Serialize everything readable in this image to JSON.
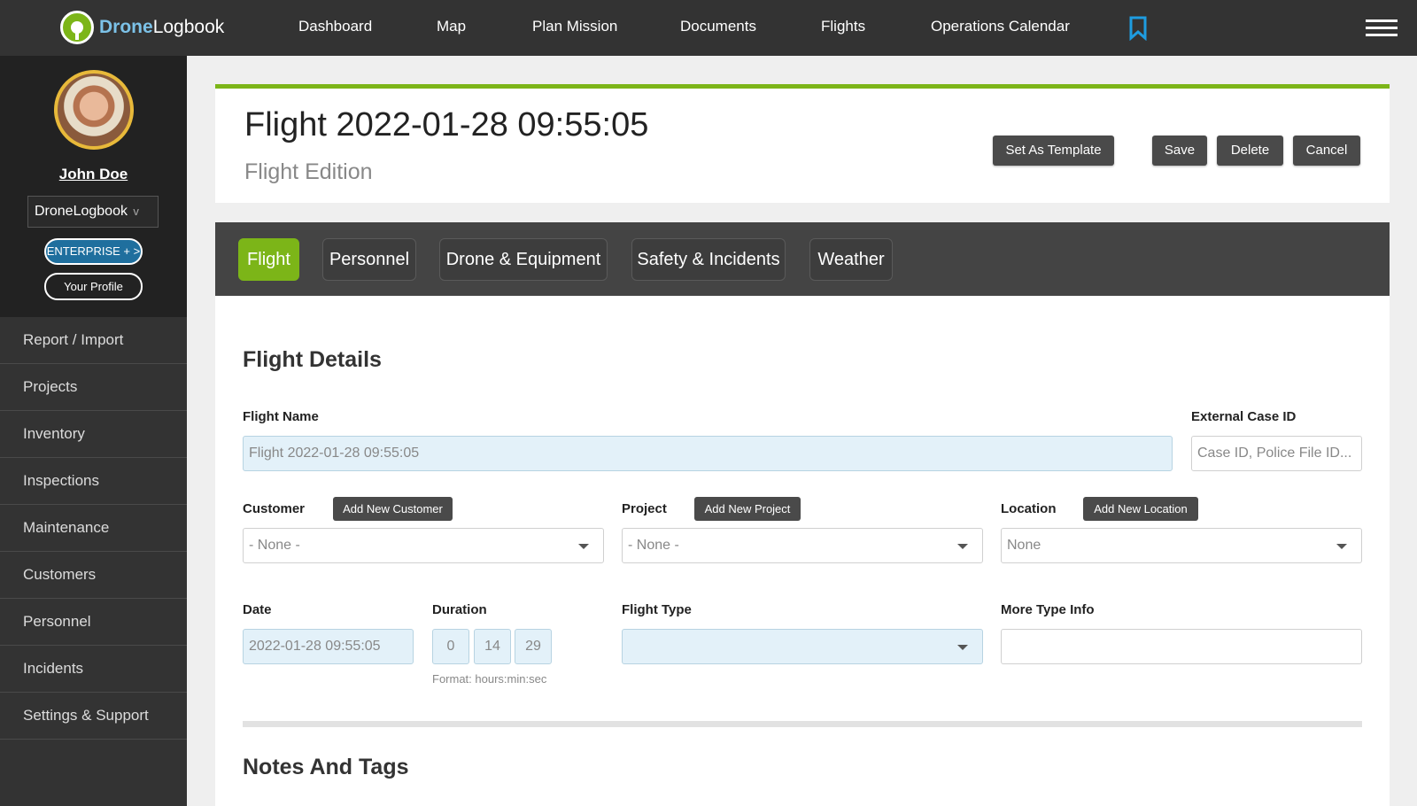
{
  "brand": {
    "name_a": "Drone",
    "name_b": "Logbook"
  },
  "nav": [
    "Dashboard",
    "Map",
    "Plan Mission",
    "Documents",
    "Flights",
    "Operations Calendar"
  ],
  "user": {
    "name": "John Doe",
    "org": "DroneLogbook",
    "org_chevron": "v",
    "plan": "ENTERPRISE + >",
    "profile_label": "Your Profile"
  },
  "sidebar": [
    "Report / Import",
    "Projects",
    "Inventory",
    "Inspections",
    "Maintenance",
    "Customers",
    "Personnel",
    "Incidents",
    "Settings & Support"
  ],
  "header": {
    "title": "Flight 2022-01-28 09:55:05",
    "subtitle": "Flight Edition",
    "buttons": {
      "template": "Set As Template",
      "save": "Save",
      "delete": "Delete",
      "cancel": "Cancel"
    }
  },
  "tabs": [
    {
      "label": "Flight",
      "active": true
    },
    {
      "label": "Personnel",
      "active": false
    },
    {
      "label": "Drone & Equipment",
      "active": false
    },
    {
      "label": "Safety & Incidents",
      "active": false
    },
    {
      "label": "Weather",
      "active": false
    }
  ],
  "form": {
    "section_title": "Flight Details",
    "flight_name": {
      "label": "Flight Name",
      "value": "Flight 2022-01-28 09:55:05"
    },
    "external_case": {
      "label": "External Case ID",
      "placeholder": "Case ID, Police File ID..."
    },
    "customer": {
      "label": "Customer",
      "button": "Add New Customer",
      "value": "- None -"
    },
    "project": {
      "label": "Project",
      "button": "Add New Project",
      "value": "- None -"
    },
    "location": {
      "label": "Location",
      "button": "Add New Location",
      "value": "None"
    },
    "date": {
      "label": "Date",
      "value": "2022-01-28 09:55:05"
    },
    "duration": {
      "label": "Duration",
      "hours": "0",
      "minutes": "14",
      "seconds": "29",
      "hint": "Format: hours:min:sec"
    },
    "flight_type": {
      "label": "Flight Type",
      "value": ""
    },
    "more_type": {
      "label": "More Type Info",
      "value": ""
    }
  },
  "notes": {
    "section_title": "Notes And Tags"
  },
  "colors": {
    "accent": "#7cb518",
    "dark": "#333333",
    "info_blue": "#1f6f9e"
  }
}
